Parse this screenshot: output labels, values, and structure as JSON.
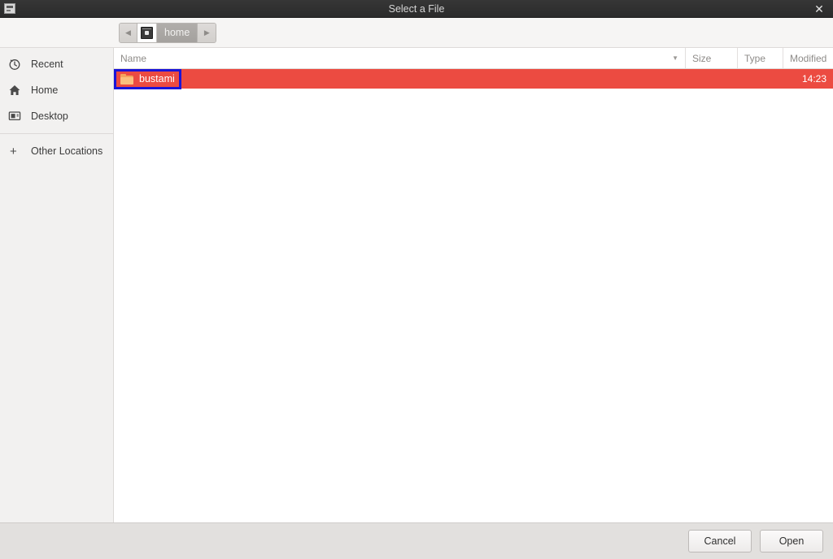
{
  "window": {
    "title": "Select a File",
    "app_icon": "application-icon",
    "close_label": "✕"
  },
  "pathbar": {
    "back_label": "◀",
    "forward_label": "▶",
    "device_icon": "filesystem-drive-icon",
    "crumbs": [
      {
        "label": "home",
        "active": true
      }
    ]
  },
  "sidebar": {
    "items": [
      {
        "label": "Recent",
        "icon": "clock-icon"
      },
      {
        "label": "Home",
        "icon": "home-icon"
      },
      {
        "label": "Desktop",
        "icon": "desktop-icon"
      }
    ],
    "other": {
      "label": "Other Locations",
      "icon": "plus-icon"
    }
  },
  "filelist": {
    "columns": {
      "name": "Name",
      "size": "Size",
      "type": "Type",
      "modified": "Modified"
    },
    "sort_indicator": "▼",
    "rows": [
      {
        "name": "bustami",
        "icon": "folder-icon",
        "size": "",
        "type": "",
        "modified": "14:23",
        "selected": true
      }
    ]
  },
  "actions": {
    "cancel_label": "Cancel",
    "open_label": "Open"
  },
  "colors": {
    "selection": "#ec4b41",
    "annotation": "#1a14d8",
    "titlebar": "#2e2e2e",
    "folder": "#f5a35c"
  }
}
